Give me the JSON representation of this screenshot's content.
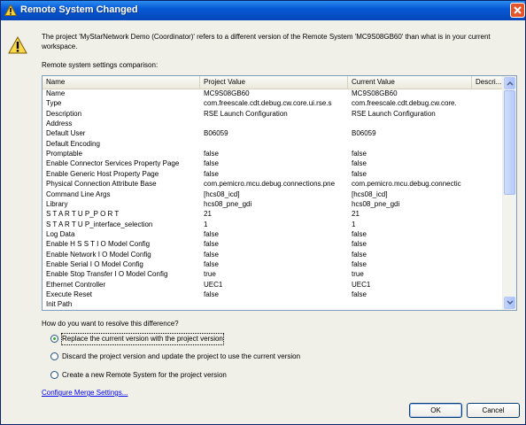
{
  "window": {
    "title": "Remote System Changed"
  },
  "message": "The project 'MyStarNetwork Demo (Coordinator)' refers to a different version of the Remote System 'MC9S08GB60' than what is in your current workspace.",
  "comparison_label": "Remote system settings comparison:",
  "table": {
    "columns": [
      "Name",
      "Project Value",
      "Current Value",
      "Descri..."
    ],
    "rows": [
      [
        "Name",
        "MC9S08GB60",
        "MC9S08GB60"
      ],
      [
        "Type",
        "com.freescale.cdt.debug.cw.core.ui.rse.s",
        "com.freescale.cdt.debug.cw.core."
      ],
      [
        "Description",
        "RSE Launch Configuration",
        "RSE Launch Configuration"
      ],
      [
        "Address",
        "",
        ""
      ],
      [
        "Default User",
        "B06059",
        "B06059"
      ],
      [
        "Default Encoding",
        "",
        ""
      ],
      [
        "Promptable",
        "false",
        "false"
      ],
      [
        "Enable Connector Services Property Page",
        "false",
        "false"
      ],
      [
        "Enable Generic Host Property Page",
        "false",
        "false"
      ],
      [
        "Physical Connection Attribute Base",
        "com.pemicro.mcu.debug.connections.pne",
        "com.pemicro.mcu.debug.connectic"
      ],
      [
        "Command Line Args",
        "[hcs08_icd]",
        "[hcs08_icd]"
      ],
      [
        "Library",
        "hcs08_pne_gdi",
        "hcs08_pne_gdi"
      ],
      [
        "S T A R T U P_P O R T",
        "21",
        "21"
      ],
      [
        "S T A R T U P_interface_selection",
        "1",
        "1"
      ],
      [
        "Log Data",
        "false",
        "false"
      ],
      [
        "Enable H S S T I O Model Config",
        "false",
        "false"
      ],
      [
        "Enable Network I O Model Config",
        "false",
        "false"
      ],
      [
        "Enable Serial I O Model Config",
        "false",
        "false"
      ],
      [
        "Enable Stop Transfer I O Model Config",
        "true",
        "true"
      ],
      [
        "Ethernet Controller",
        "UEC1",
        "UEC1"
      ],
      [
        "Execute Reset",
        "false",
        "false"
      ],
      [
        "Init Path",
        "",
        ""
      ]
    ]
  },
  "question": "How do you want to resolve this difference?",
  "options": [
    {
      "label": "Replace the current version with the project version",
      "selected": true
    },
    {
      "label": "Discard the project version and update the project to use the current version",
      "selected": false
    },
    {
      "label": "Create a new Remote System for the project version",
      "selected": false
    }
  ],
  "link": "Configure Merge Settings...",
  "buttons": {
    "ok": "OK",
    "cancel": "Cancel"
  }
}
